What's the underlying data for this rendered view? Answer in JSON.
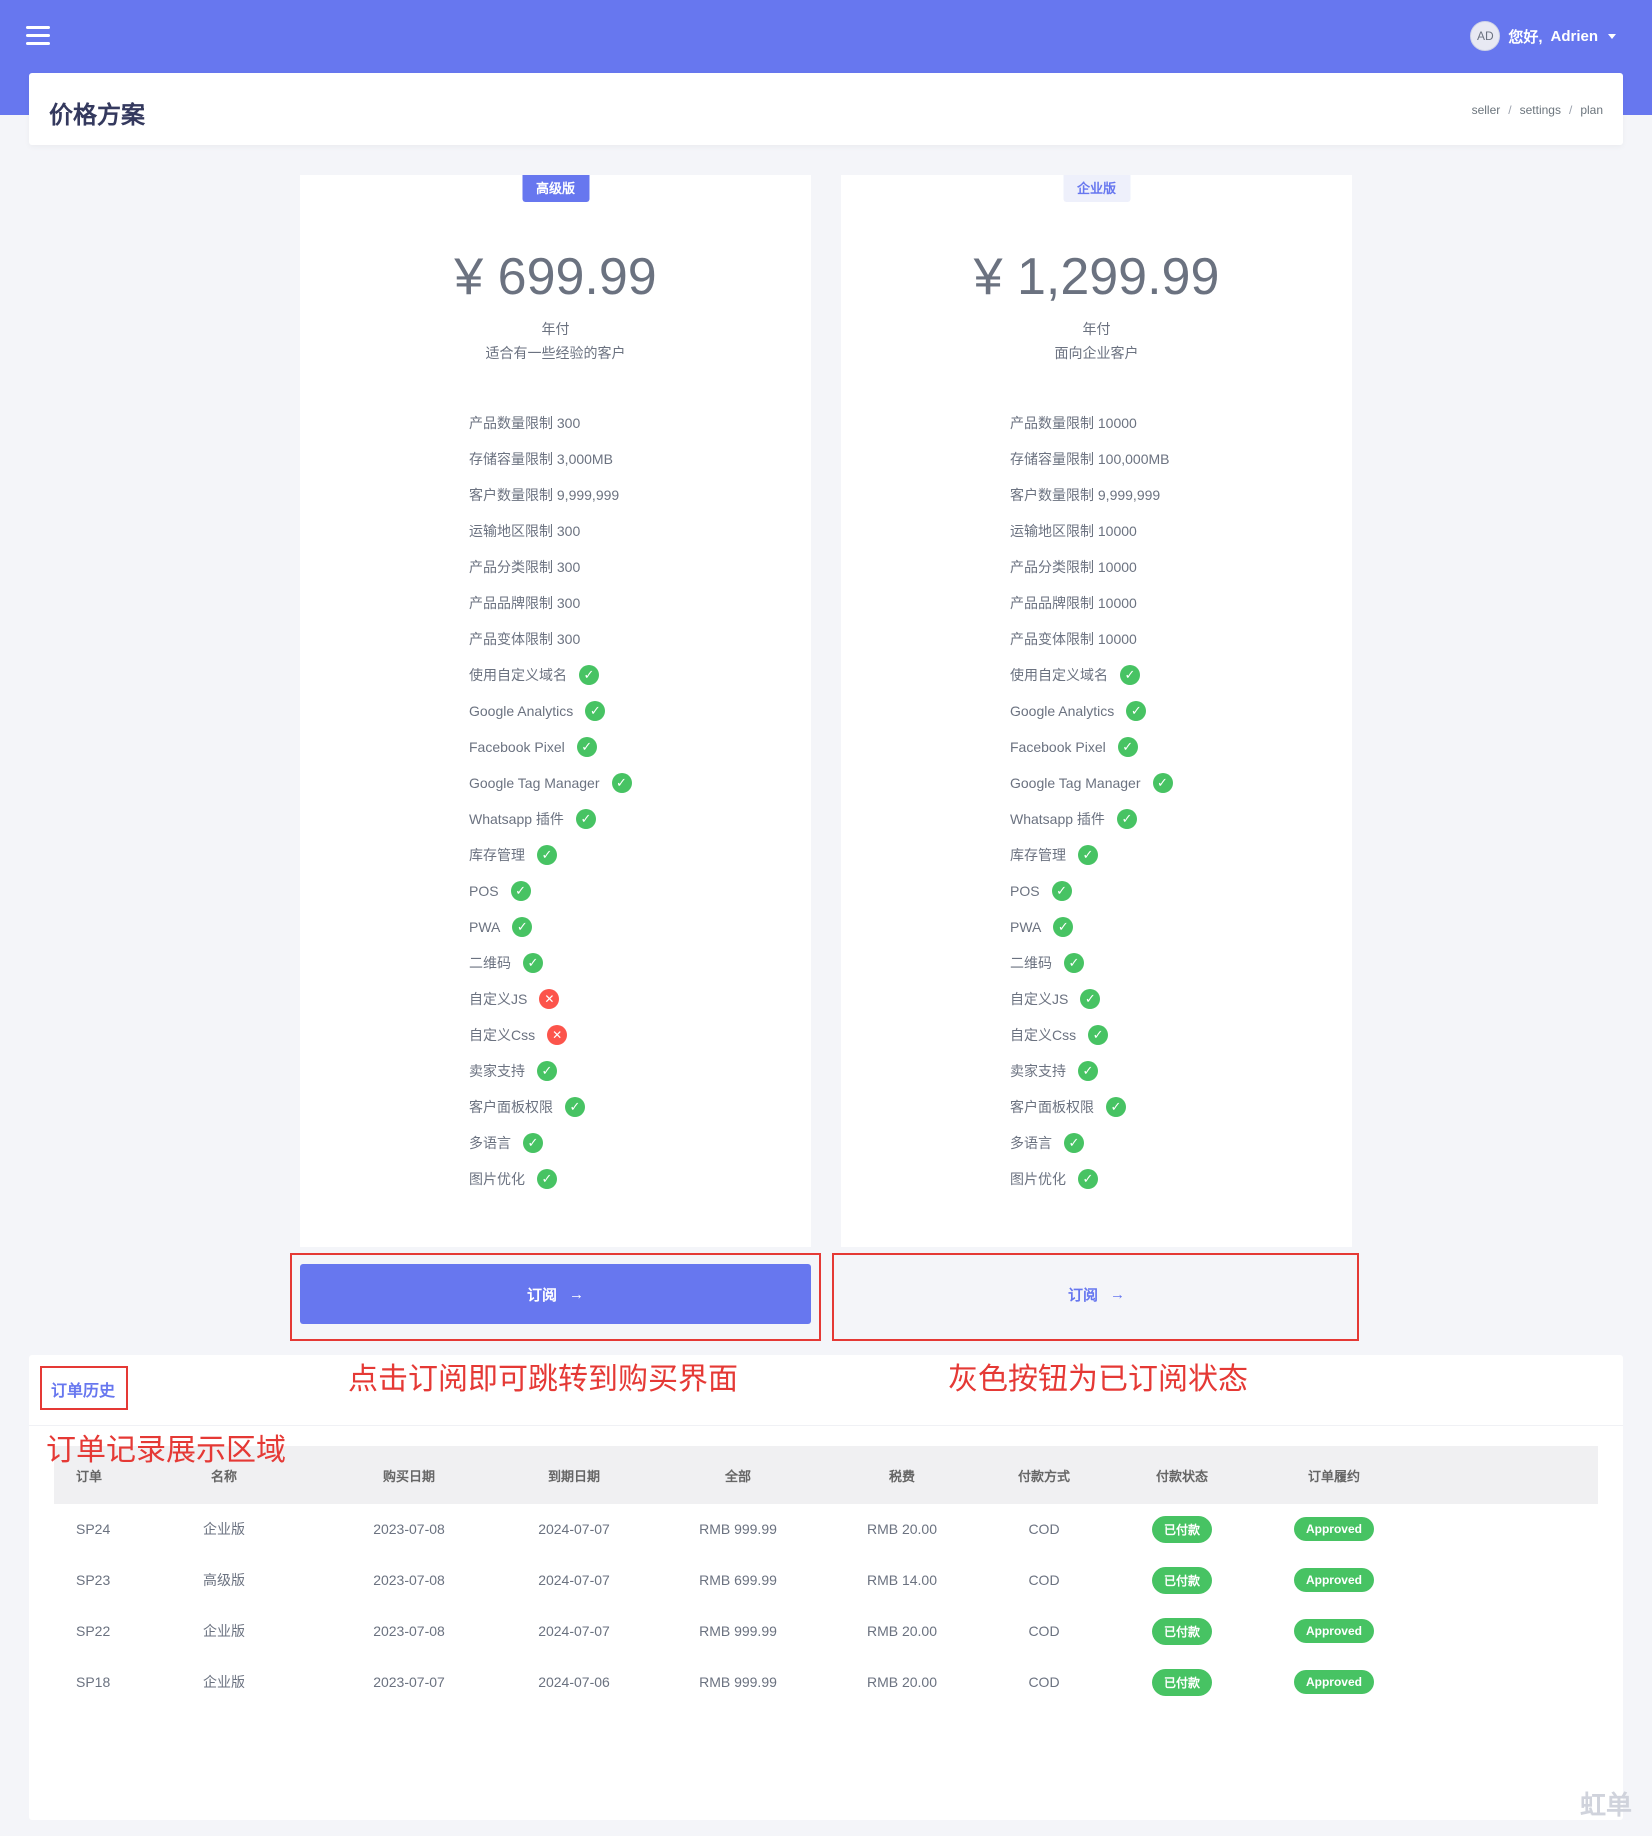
{
  "topbar": {
    "avatar_initials": "AD",
    "greeting": "您好,",
    "username": "Adrien"
  },
  "page": {
    "title": "价格方案",
    "breadcrumb": [
      "seller",
      "settings",
      "plan"
    ]
  },
  "plans": [
    {
      "badge": "高级版",
      "price": "¥ 699.99",
      "period": "年付",
      "description": "适合有一些经验的客户",
      "features": [
        {
          "label": "产品数量限制 300"
        },
        {
          "label": "存储容量限制 3,000MB"
        },
        {
          "label": "客户数量限制 9,999,999"
        },
        {
          "label": "运输地区限制 300"
        },
        {
          "label": "产品分类限制 300"
        },
        {
          "label": "产品品牌限制 300"
        },
        {
          "label": "产品变体限制 300"
        },
        {
          "label": "使用自定义域名",
          "status": "yes"
        },
        {
          "label": "Google Analytics",
          "status": "yes"
        },
        {
          "label": "Facebook Pixel",
          "status": "yes"
        },
        {
          "label": "Google Tag Manager",
          "status": "yes"
        },
        {
          "label": "Whatsapp 插件",
          "status": "yes"
        },
        {
          "label": "库存管理",
          "status": "yes"
        },
        {
          "label": "POS",
          "status": "yes"
        },
        {
          "label": "PWA",
          "status": "yes"
        },
        {
          "label": "二维码",
          "status": "yes"
        },
        {
          "label": "自定义JS",
          "status": "no"
        },
        {
          "label": "自定义Css",
          "status": "no"
        },
        {
          "label": "卖家支持",
          "status": "yes"
        },
        {
          "label": "客户面板权限",
          "status": "yes"
        },
        {
          "label": "多语言",
          "status": "yes"
        },
        {
          "label": "图片优化",
          "status": "yes"
        }
      ],
      "button": "订阅"
    },
    {
      "badge": "企业版",
      "price": "¥ 1,299.99",
      "period": "年付",
      "description": "面向企业客户",
      "features": [
        {
          "label": "产品数量限制 10000"
        },
        {
          "label": "存储容量限制 100,000MB"
        },
        {
          "label": "客户数量限制 9,999,999"
        },
        {
          "label": "运输地区限制 10000"
        },
        {
          "label": "产品分类限制 10000"
        },
        {
          "label": "产品品牌限制 10000"
        },
        {
          "label": "产品变体限制 10000"
        },
        {
          "label": "使用自定义域名",
          "status": "yes"
        },
        {
          "label": "Google Analytics",
          "status": "yes"
        },
        {
          "label": "Facebook Pixel",
          "status": "yes"
        },
        {
          "label": "Google Tag Manager",
          "status": "yes"
        },
        {
          "label": "Whatsapp 插件",
          "status": "yes"
        },
        {
          "label": "库存管理",
          "status": "yes"
        },
        {
          "label": "POS",
          "status": "yes"
        },
        {
          "label": "PWA",
          "status": "yes"
        },
        {
          "label": "二维码",
          "status": "yes"
        },
        {
          "label": "自定义JS",
          "status": "yes"
        },
        {
          "label": "自定义Css",
          "status": "yes"
        },
        {
          "label": "卖家支持",
          "status": "yes"
        },
        {
          "label": "客户面板权限",
          "status": "yes"
        },
        {
          "label": "多语言",
          "status": "yes"
        },
        {
          "label": "图片优化",
          "status": "yes"
        }
      ],
      "button": "订阅"
    }
  ],
  "annotations": {
    "subscribe_hint": "点击订阅即可跳转到购买界面",
    "subscribed_hint": "灰色按钮为已订阅状态",
    "orders_hint": "订单记录展示区域"
  },
  "orders": {
    "title": "订单历史",
    "columns": [
      "订单",
      "名称",
      "购买日期",
      "到期日期",
      "全部",
      "税费",
      "付款方式",
      "付款状态",
      "订单履约"
    ],
    "rows": [
      [
        "SP24",
        "企业版",
        "2023-07-08",
        "2024-07-07",
        "RMB 999.99",
        "RMB 20.00",
        "COD",
        "已付款",
        "Approved"
      ],
      [
        "SP23",
        "高级版",
        "2023-07-08",
        "2024-07-07",
        "RMB 699.99",
        "RMB 14.00",
        "COD",
        "已付款",
        "Approved"
      ],
      [
        "SP22",
        "企业版",
        "2023-07-08",
        "2024-07-07",
        "RMB 999.99",
        "RMB 20.00",
        "COD",
        "已付款",
        "Approved"
      ],
      [
        "SP18",
        "企业版",
        "2023-07-07",
        "2024-07-06",
        "RMB 999.99",
        "RMB 20.00",
        "COD",
        "已付款",
        "Approved"
      ]
    ]
  },
  "watermark": "虹单",
  "icons": {
    "menu": "hamburger-icon",
    "check": "check-circle-icon",
    "cross": "x-circle-icon",
    "arrow": "arrow-right-icon"
  },
  "colors": {
    "primary": "#6777ef",
    "success": "#47c363",
    "danger": "#fc544b",
    "annotation": "#e53935"
  }
}
